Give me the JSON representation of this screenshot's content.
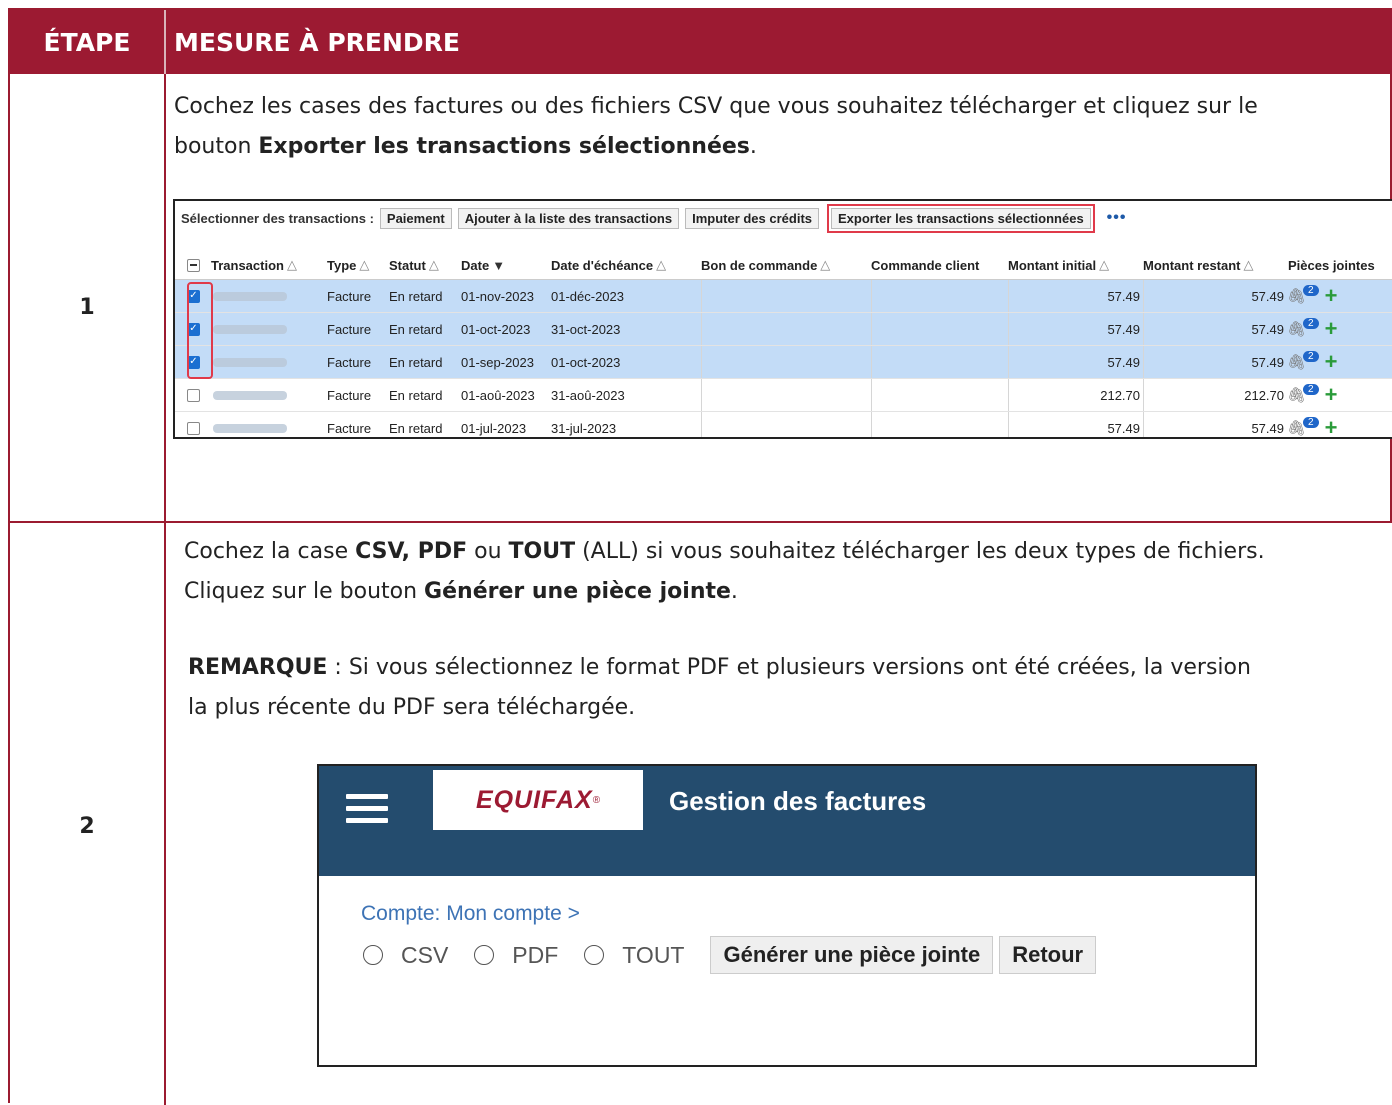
{
  "header": {
    "col_step": "ÉTAPE",
    "col_action": "MESURE À PRENDRE"
  },
  "steps": [
    {
      "number": "1",
      "line1": "Cochez les cases des factures ou des fichiers CSV que vous souhaitez télécharger et cliquez sur le",
      "line2_pre": "bouton ",
      "line2_bold": "Exporter les transactions sélectionnées",
      "line2_post": "."
    },
    {
      "number": "2",
      "line1_pre": "Cochez la case ",
      "line1_b1": "CSV, PDF",
      "line1_mid": " ou ",
      "line1_b2": "TOUT",
      "line1_post": " (ALL) si vous souhaitez télécharger les deux types de fichiers.",
      "line2_pre": "Cliquez sur le bouton ",
      "line2_bold": "Générer une pièce jointe",
      "line2_post": ".",
      "note_bold": "REMARQUE",
      "note_line1": " : Si vous sélectionnez le format PDF et plusieurs versions ont été créées, la version",
      "note_line2": "la plus récente du PDF sera téléchargée."
    }
  ],
  "transactions_screen": {
    "toolbar_label": "Sélectionner des transactions :",
    "buttons": [
      "Paiement",
      "Ajouter à la liste des transactions",
      "Imputer des crédits",
      "Exporter les transactions sélectionnées"
    ],
    "more": "•••",
    "columns": [
      "Transaction",
      "Type",
      "Statut",
      "Date",
      "Date d'échéance",
      "Bon de commande",
      "Commande client",
      "Montant initial",
      "Montant restant",
      "Pièces jointes"
    ],
    "rows": [
      {
        "checked": true,
        "type": "Facture",
        "status": "En retard",
        "date": "01-nov-2023",
        "due": "01-déc-2023",
        "initial": "57.49",
        "remaining": "57.49",
        "attachments": "2"
      },
      {
        "checked": true,
        "type": "Facture",
        "status": "En retard",
        "date": "01-oct-2023",
        "due": "31-oct-2023",
        "initial": "57.49",
        "remaining": "57.49",
        "attachments": "2"
      },
      {
        "checked": true,
        "type": "Facture",
        "status": "En retard",
        "date": "01-sep-2023",
        "due": "01-oct-2023",
        "initial": "57.49",
        "remaining": "57.49",
        "attachments": "2"
      },
      {
        "checked": false,
        "type": "Facture",
        "status": "En retard",
        "date": "01-aoû-2023",
        "due": "31-aoû-2023",
        "initial": "212.70",
        "remaining": "212.70",
        "attachments": "2"
      },
      {
        "checked": false,
        "type": "Facture",
        "status": "En retard",
        "date": "01-jul-2023",
        "due": "31-jul-2023",
        "initial": "57.49",
        "remaining": "57.49",
        "attachments": "2"
      }
    ]
  },
  "equifax_screen": {
    "logo": "EQUIFAX",
    "title": "Gestion des factures",
    "breadcrumb": "Compte: Mon compte  >",
    "options": [
      "CSV",
      "PDF",
      "TOUT"
    ],
    "generate_button": "Générer une pièce jointe",
    "back_button": "Retour"
  },
  "colors": {
    "brand_red": "#9c1a32",
    "equifax_blue": "#244c6e",
    "selected_row": "#c3dcf7",
    "highlight": "#e03a4a"
  }
}
